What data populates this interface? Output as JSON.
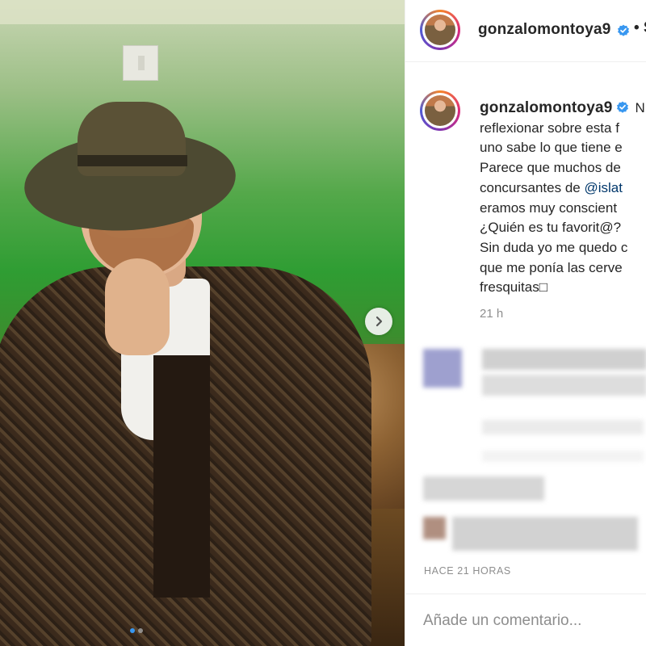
{
  "post": {
    "username": "gonzalomontoya9",
    "header_separator": "• S",
    "caption_lines": [
      "N",
      "reflexionar sobre esta f",
      "uno sabe lo que tiene e",
      "Parece que muchos de",
      "concursantes de ",
      "eramos muy conscient",
      "¿Quién es tu favorit@?",
      "Sin duda yo me quedo c",
      "que me ponía las cerve",
      "fresquitas□"
    ],
    "mention": "@islat",
    "time": "21 h",
    "ago_label": "HACE 21 HORAS",
    "carousel": {
      "count": 2,
      "active": 0
    }
  },
  "comment_box": {
    "placeholder": "Añade un comentario..."
  },
  "colors": {
    "verified": "#3897f0",
    "accent": "#3897f0",
    "mention": "#00376b"
  },
  "icons": [
    "chevron-right-icon",
    "verified-badge-icon"
  ]
}
